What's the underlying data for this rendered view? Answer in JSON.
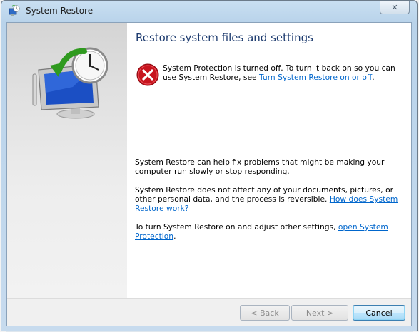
{
  "window": {
    "title": "System Restore",
    "close_symbol": "✕"
  },
  "main": {
    "heading": "Restore system files and settings",
    "error": {
      "text_before": "System Protection is turned off. To turn it back on so you can use System Restore, see ",
      "link": "Turn System Restore on or off",
      "text_after": "."
    },
    "para1": "System Restore can help fix problems that might be making your computer run slowly or stop responding.",
    "para2": {
      "text": "System Restore does not affect any of your documents, pictures, or other personal data, and the process is reversible. ",
      "link": "How does System Restore work?"
    },
    "para3": {
      "text": "To turn System Restore on and adjust other settings, ",
      "link": "open System Protection",
      "text_after": "."
    }
  },
  "footer": {
    "back_label": "< Back",
    "next_label": "Next >",
    "cancel_label": "Cancel"
  },
  "icons": {
    "app": "system-restore-icon",
    "illustration": "monitor-clock-illustration",
    "error": "error-icon",
    "close": "close-icon"
  },
  "colors": {
    "heading": "#1c3a6e",
    "link": "#0066cc",
    "error_red": "#c8141e"
  }
}
